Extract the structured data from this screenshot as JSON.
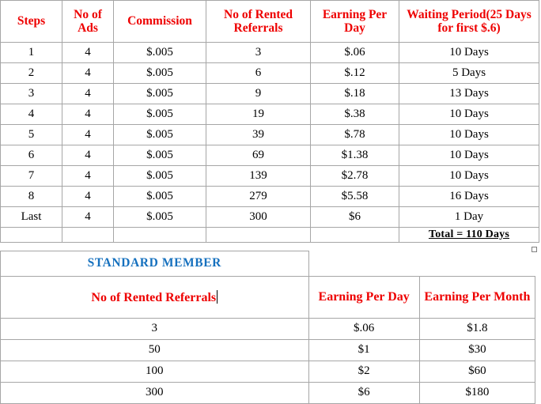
{
  "commission_table": {
    "name": "Commission / Waiting Period Plan",
    "headers": [
      "Steps",
      "No of Ads",
      "Commission",
      "No of Rented Referrals",
      "Earning Per Day",
      "Waiting Period(25 Days for first $.6)"
    ],
    "rows": [
      [
        "1",
        "4",
        "$.005",
        "3",
        "$.06",
        "10 Days"
      ],
      [
        "2",
        "4",
        "$.005",
        "6",
        "$.12",
        "5 Days"
      ],
      [
        "3",
        "4",
        "$.005",
        "9",
        "$.18",
        "13 Days"
      ],
      [
        "4",
        "4",
        "$.005",
        "19",
        "$.38",
        "10 Days"
      ],
      [
        "5",
        "4",
        "$.005",
        "39",
        "$.78",
        "10 Days"
      ],
      [
        "6",
        "4",
        "$.005",
        "69",
        "$1.38",
        "10 Days"
      ],
      [
        "7",
        "4",
        "$.005",
        "139",
        "$2.78",
        "10 Days"
      ],
      [
        "8",
        "4",
        "$.005",
        "279",
        "$5.58",
        "16 Days"
      ],
      [
        "Last",
        "4",
        "$.005",
        "300",
        "$6",
        "1 Day"
      ]
    ],
    "total_label": "Total = 110 Days"
  },
  "standard_table": {
    "banner": "STANDARD MEMBER",
    "headers": [
      "No of Rented Referrals",
      "Earning Per Day",
      "Earning Per Month"
    ],
    "rows": [
      [
        "3",
        "$.06",
        "$1.8"
      ],
      [
        "50",
        "$1",
        "$30"
      ],
      [
        "100",
        "$2",
        "$60"
      ],
      [
        "300",
        "$6",
        "$180"
      ]
    ]
  },
  "colors": {
    "header_red": "#ee0000",
    "banner_blue": "#1570be",
    "text_black": "#000000",
    "grid_line": "#a6a6a6"
  }
}
